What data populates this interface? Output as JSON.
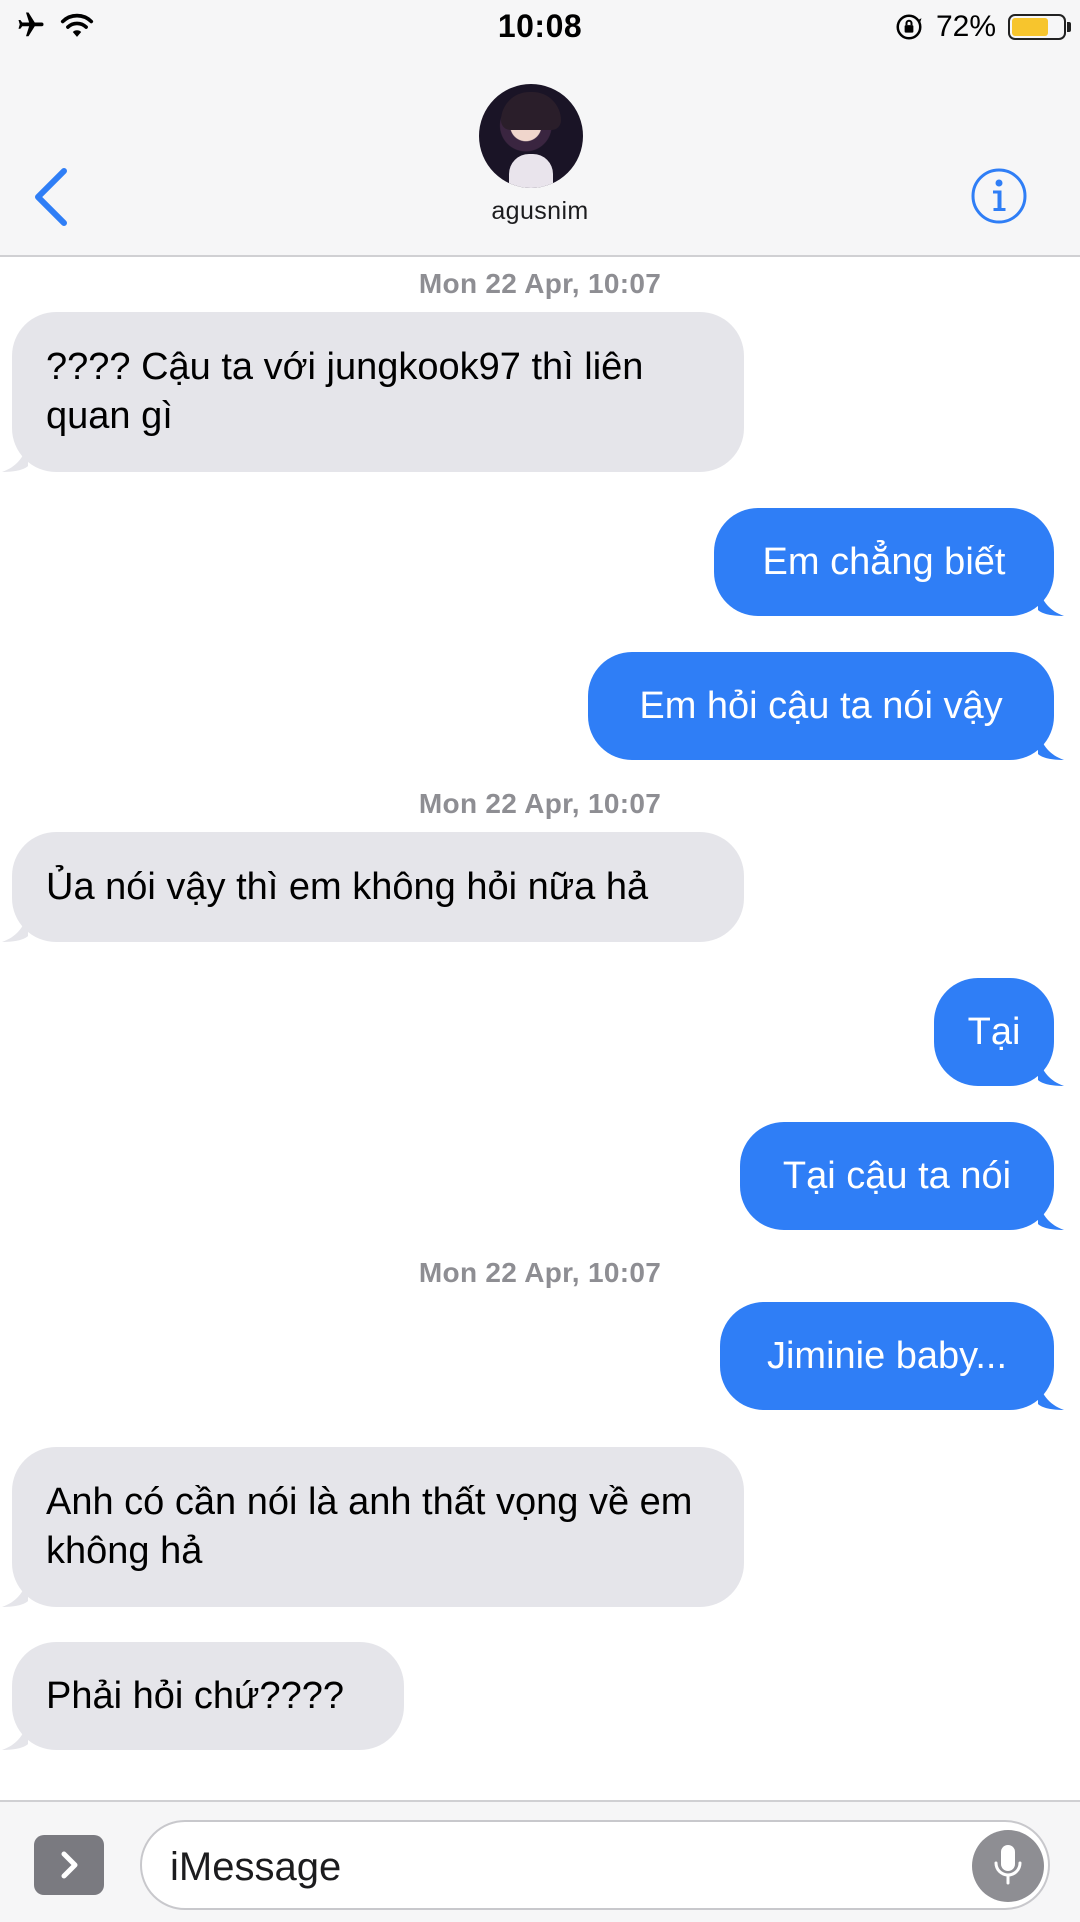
{
  "status_bar": {
    "time": "10:08",
    "battery_percent": "72%",
    "battery_level": 0.72,
    "icons": [
      "airplane-icon",
      "wifi-icon",
      "orientation-lock-icon",
      "battery-icon"
    ]
  },
  "header": {
    "contact_name": "agusnim",
    "back_icon": "chevron-left-icon",
    "info_icon": "info-icon"
  },
  "messages": [
    {
      "type": "timestamp",
      "text": "Mon 22 Apr, 10:07"
    },
    {
      "type": "incoming",
      "text": "???? Cậu ta với jungkook97 thì liên quan gì"
    },
    {
      "type": "outgoing",
      "text": "Em chẳng biết"
    },
    {
      "type": "outgoing",
      "text": "Em hỏi cậu ta nói vậy"
    },
    {
      "type": "timestamp",
      "text": "Mon 22 Apr, 10:07"
    },
    {
      "type": "incoming",
      "text": "Ủa nói vậy thì em không hỏi nữa hả"
    },
    {
      "type": "outgoing",
      "text": "Tại"
    },
    {
      "type": "outgoing",
      "text": "Tại cậu ta nói"
    },
    {
      "type": "timestamp",
      "text": "Mon 22 Apr, 10:07"
    },
    {
      "type": "outgoing",
      "text": "Jiminie baby..."
    },
    {
      "type": "incoming",
      "text": "Anh có cần nói là anh thất vọng về em không hả"
    },
    {
      "type": "incoming",
      "text": "Phải hỏi chứ????"
    }
  ],
  "input_bar": {
    "placeholder": "iMessage",
    "apps_icon": "chevron-right-icon",
    "mic_icon": "microphone-icon"
  },
  "colors": {
    "outgoing_bubble": "#2f7ef6",
    "incoming_bubble": "#e5e5ea",
    "accent": "#2f7ef6",
    "timestamp": "#8e8e93"
  }
}
